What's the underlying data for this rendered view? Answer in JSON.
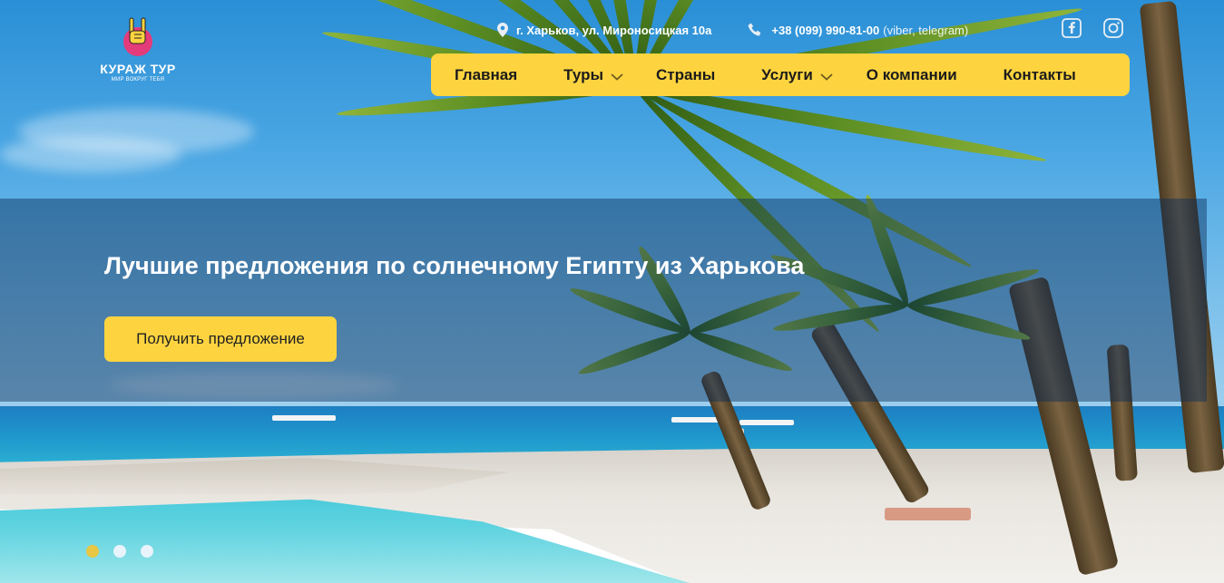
{
  "brand": {
    "name": "КУРАЖ ТУР",
    "slogan": "МИР ВОКРУГ ТЕБЯ",
    "icon": "rock-hand-logo-icon",
    "colors": {
      "accent": "#fdd43f",
      "logo_circle": "#e43b7a",
      "text_dark": "#1b1b1b"
    }
  },
  "contacts": {
    "address": "г. Харьков, ул. Мироносицкая 10а",
    "address_icon": "map-pin-icon",
    "phone": "+38 (099) 990-81-00",
    "phone_note": "(viber, telegram)",
    "phone_icon": "phone-icon"
  },
  "social": [
    {
      "name": "facebook",
      "icon": "facebook-icon"
    },
    {
      "name": "instagram",
      "icon": "instagram-icon"
    }
  ],
  "nav": {
    "items": [
      {
        "label": "Главная",
        "dropdown": false
      },
      {
        "label": "Туры",
        "dropdown": true
      },
      {
        "label": "Страны",
        "dropdown": false
      },
      {
        "label": "Услуги",
        "dropdown": true
      },
      {
        "label": "О компании",
        "dropdown": false
      },
      {
        "label": "Контакты",
        "dropdown": false
      }
    ]
  },
  "hero": {
    "title": "Лучшие предложения по солнечному Египту из Харькова",
    "cta_label": "Получить предложение",
    "slides_total": 3,
    "active_slide": 1
  }
}
